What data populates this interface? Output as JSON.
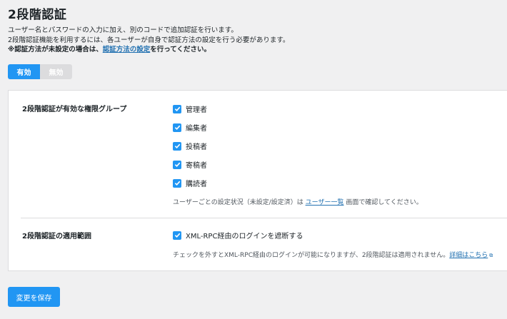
{
  "page": {
    "title": "2段階認証"
  },
  "description": {
    "line1": "ユーザー名とパスワードの入力に加え、別のコードで追加認証を行います。",
    "line2": "2段階認証機能を利用するには、各ユーザーが自身で認証方法の設定を行う必要があります。",
    "line3_prefix": "※認証方法が未設定の場合は、",
    "line3_link": "認証方法の設定",
    "line3_suffix": "を行ってください。"
  },
  "toggle": {
    "enabled_label": "有効",
    "disabled_label": "無効",
    "selected": "有効"
  },
  "groups_section": {
    "label": "2段階認証が有効な権限グループ",
    "items": [
      {
        "label": "管理者",
        "checked": true
      },
      {
        "label": "編集者",
        "checked": true
      },
      {
        "label": "投稿者",
        "checked": true
      },
      {
        "label": "寄稿者",
        "checked": true
      },
      {
        "label": "購読者",
        "checked": true
      }
    ],
    "note_prefix": "ユーザーごとの設定状況（未設定/設定済）は ",
    "note_link": "ユーザー一覧",
    "note_suffix": " 画面で確認してください。"
  },
  "scope_section": {
    "label": "2段階認証の適用範囲",
    "item": {
      "label": "XML-RPC経由のログインを遮断する",
      "checked": true
    },
    "note_prefix": "チェックを外すとXML-RPC経由のログインが可能になりますが、2段階認証は適用されません。",
    "note_link": "詳細はこちら"
  },
  "actions": {
    "save_label": "変更を保存"
  },
  "colors": {
    "accent": "#2196f3",
    "link": "#2271b1",
    "background": "#f0f0f1"
  },
  "icons": {
    "checkbox": "check-icon",
    "external": "external-link-icon"
  }
}
